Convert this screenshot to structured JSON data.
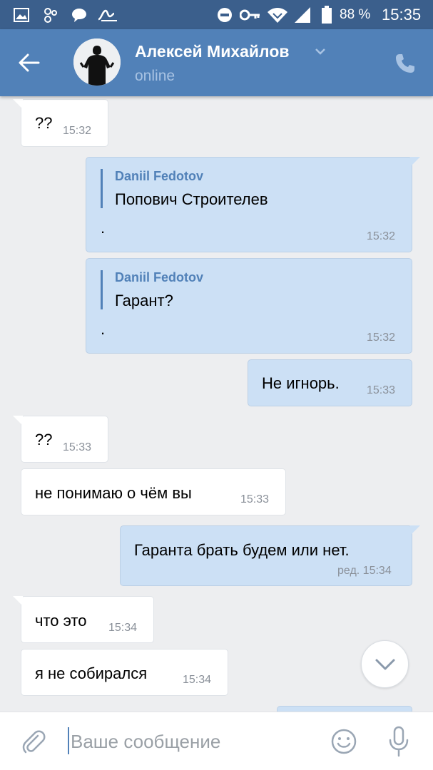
{
  "status_bar": {
    "icons": [
      "gallery-icon",
      "people-icon",
      "chat-bubble-icon",
      "wave-icon",
      "do-not-disturb-icon",
      "key-icon",
      "wifi-icon",
      "signal-icon",
      "battery-icon"
    ],
    "battery": "88 %",
    "time": "15:35"
  },
  "header": {
    "contact_name": "Алексей Михайлов",
    "status": "online"
  },
  "messages": [
    {
      "dir": "in",
      "text": "??",
      "time": "15:32"
    },
    {
      "dir": "out",
      "quote_author": "Daniil Fedotov",
      "quote_text": "Попович Строителев",
      "text": ".",
      "time": "15:32"
    },
    {
      "dir": "out",
      "quote_author": "Daniil Fedotov",
      "quote_text": "Гарант?",
      "text": ".",
      "time": "15:32"
    },
    {
      "dir": "out",
      "text": "Не игнорь.",
      "time": "15:33"
    },
    {
      "dir": "in",
      "text": "??",
      "time": "15:33"
    },
    {
      "dir": "in",
      "text": "не понимаю о чём вы",
      "time": "15:33"
    },
    {
      "dir": "out",
      "text": "Гаранта брать будем или нет.",
      "time": "ред. 15:34"
    },
    {
      "dir": "in",
      "text": "что это",
      "time": "15:34"
    },
    {
      "dir": "in",
      "text": "я не собирался",
      "time": "15:34"
    }
  ],
  "composer": {
    "placeholder": "Ваше сообщение"
  },
  "colors": {
    "status_bar": "#3b5f8c",
    "app_bar": "#5181b8",
    "chat_bg": "#edeef0",
    "incoming_bubble": "#ffffff",
    "outgoing_bubble": "#cce0f5",
    "accent": "#5181b8"
  }
}
